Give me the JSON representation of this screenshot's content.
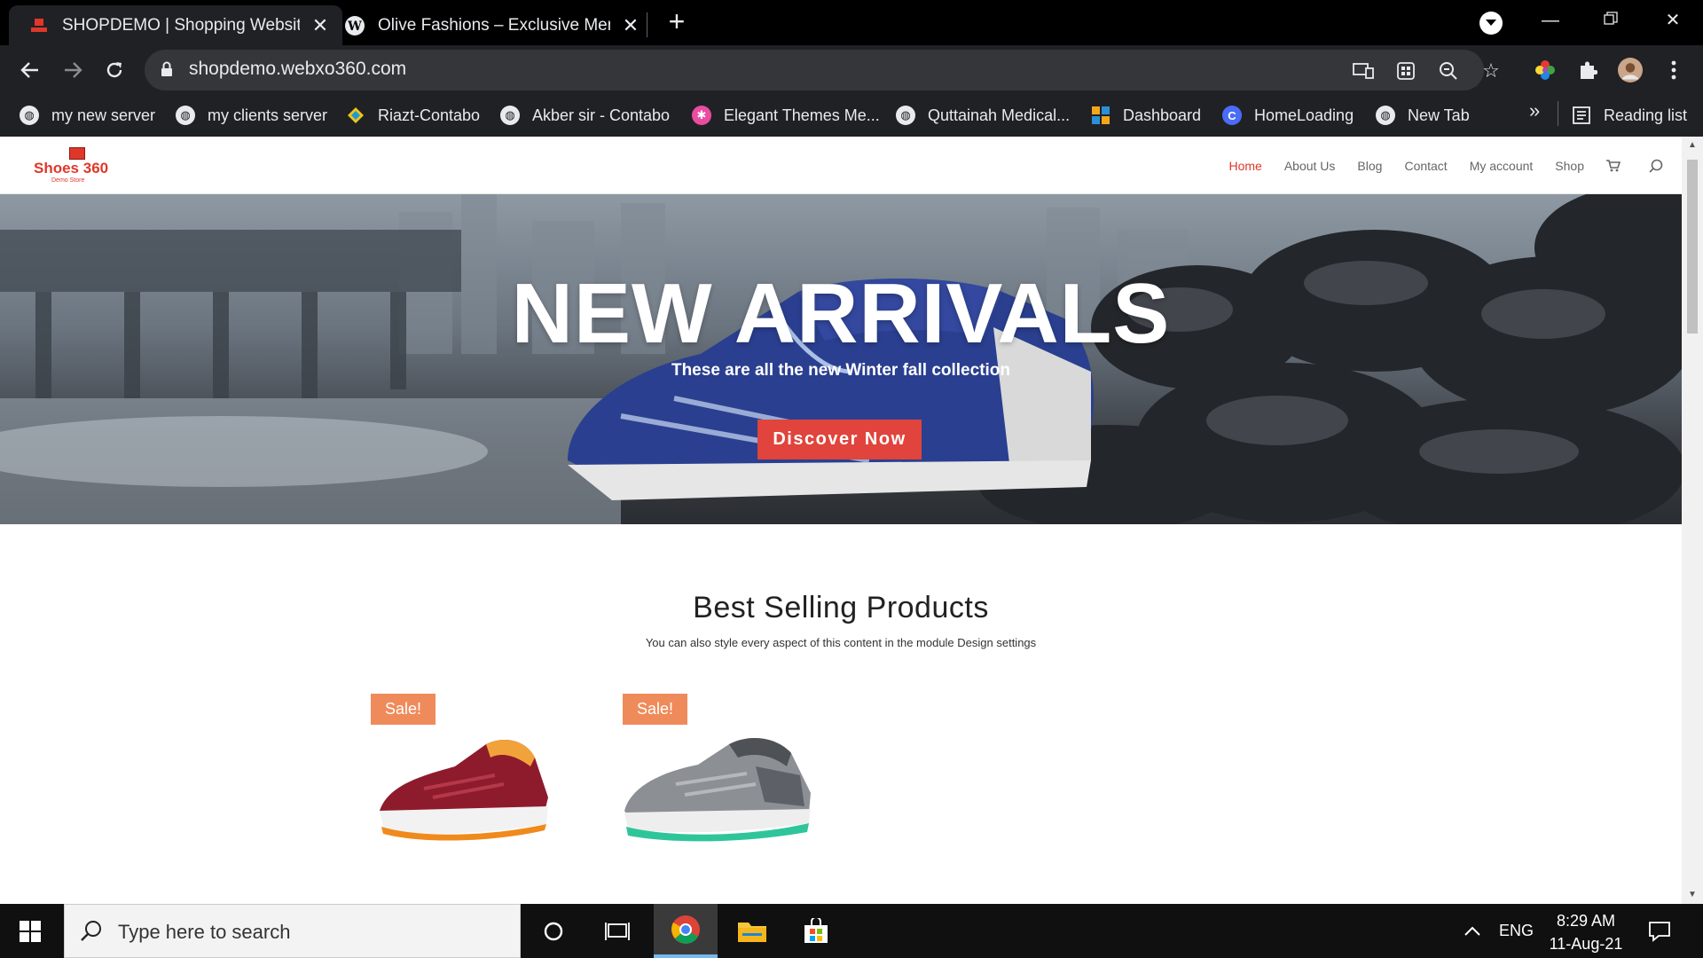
{
  "browser": {
    "tabs": [
      {
        "title": "SHOPDEMO | Shopping Website",
        "active": true
      },
      {
        "title": "Olive Fashions – Exclusive Mens C",
        "active": false
      }
    ],
    "url": "shopdemo.webxo360.com",
    "bookmarks": [
      {
        "label": "my new server",
        "icon": "globe-icon"
      },
      {
        "label": "my clients server",
        "icon": "globe-icon"
      },
      {
        "label": "Riazt-Contabo",
        "icon": "contabo-icon"
      },
      {
        "label": "Akber sir - Contabo",
        "icon": "globe-icon"
      },
      {
        "label": "Elegant Themes Me...",
        "icon": "elegant-themes-icon"
      },
      {
        "label": "Quttainah Medical...",
        "icon": "globe-icon"
      },
      {
        "label": "Dashboard",
        "icon": "dashboard-icon"
      },
      {
        "label": "HomeLoading",
        "icon": "homeloading-icon"
      },
      {
        "label": "New Tab",
        "icon": "globe-icon"
      }
    ],
    "more_bookmarks": "»",
    "reading_list": "Reading list"
  },
  "site": {
    "logo": {
      "name": "Shoes 360",
      "tagline": "Demo Store"
    },
    "menu": [
      {
        "label": "Home",
        "current": true
      },
      {
        "label": "About Us",
        "current": false
      },
      {
        "label": "Blog",
        "current": false
      },
      {
        "label": "Contact",
        "current": false
      },
      {
        "label": "My account",
        "current": false
      },
      {
        "label": "Shop",
        "current": false
      }
    ],
    "hero": {
      "title": "NEW ARRIVALS",
      "subtitle": "These are all the new Winter fall collection",
      "cta": "Discover Now"
    },
    "best_selling": {
      "title": "Best Selling Products",
      "subtitle": "You can also style every aspect of this content in the module Design settings",
      "products": [
        {
          "badge": "Sale!",
          "image": "red-sneaker"
        },
        {
          "badge": "Sale!",
          "image": "grey-sneaker"
        }
      ]
    }
  },
  "taskbar": {
    "search_placeholder": "Type here to search",
    "language": "ENG",
    "time": "8:29 AM",
    "date": "11-Aug-21"
  },
  "colors": {
    "accent": "#e0372a",
    "cta": "#e0443c",
    "sale_badge": "#ef8b5a",
    "chrome_dark": "#202124"
  }
}
